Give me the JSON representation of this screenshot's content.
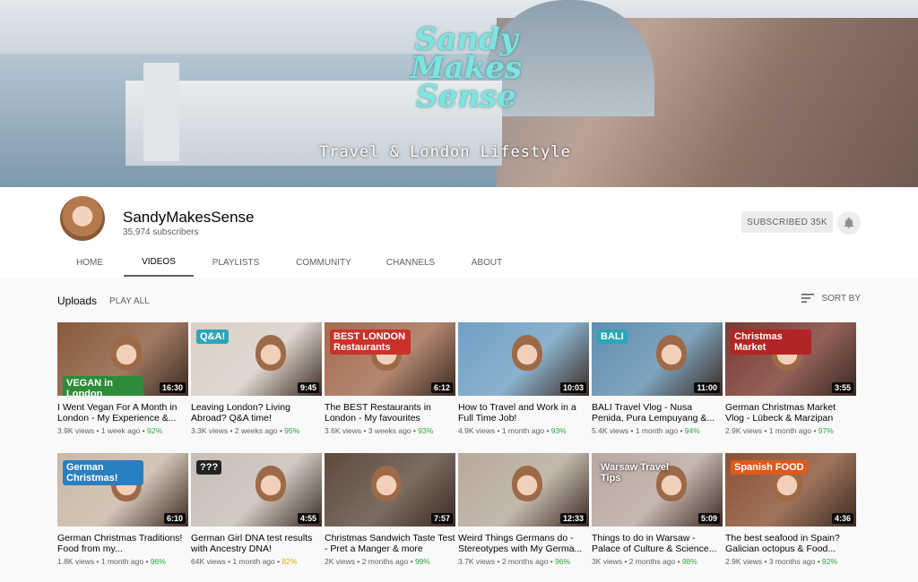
{
  "banner": {
    "logo_text": "Sandy Makes Sense",
    "tagline": "Travel & London Lifestyle"
  },
  "channel": {
    "name": "SandyMakesSense",
    "subscribers": "35,974 subscribers",
    "subscribed_label": "SUBSCRIBED 35K",
    "icons": {
      "bell": "bell-icon",
      "sort": "sort-icon"
    }
  },
  "tabs": [
    {
      "label": "HOME",
      "active": false
    },
    {
      "label": "VIDEOS",
      "active": true
    },
    {
      "label": "PLAYLISTS",
      "active": false
    },
    {
      "label": "COMMUNITY",
      "active": false
    },
    {
      "label": "CHANNELS",
      "active": false
    },
    {
      "label": "ABOUT",
      "active": false
    }
  ],
  "section": {
    "title": "Uploads",
    "play_all": "PLAY ALL",
    "sort_by": "SORT BY"
  },
  "videos": [
    {
      "title": "I Went Vegan For A Month in London - My Experience &...",
      "views": "3.9K views",
      "age": "1 week ago",
      "rating": "92%",
      "duration": "16:30",
      "thumb_text": "VEGAN in London",
      "bg": "#8a5a3c",
      "accent": "#2e8b3a"
    },
    {
      "title": "Leaving London? Living Abroad? Q&A time!",
      "views": "3.3K views",
      "age": "2 weeks ago",
      "rating": "95%",
      "duration": "9:45",
      "thumb_text": "Q&A!",
      "bg": "#d9cfc6",
      "accent": "#2aa6b8"
    },
    {
      "title": "The BEST Restaurants in London - My favourites",
      "views": "3.6K views",
      "age": "3 weeks ago",
      "rating": "93%",
      "duration": "6:12",
      "thumb_text": "BEST LONDON Restaurants",
      "bg": "#a36b4f",
      "accent": "#c8322a"
    },
    {
      "title": "How to Travel and Work in a Full Time Job!",
      "views": "4.9K views",
      "age": "1 month ago",
      "rating": "93%",
      "duration": "10:03",
      "thumb_text": "",
      "bg": "#6fa0c4",
      "accent": "#d63a2c"
    },
    {
      "title": "BALI Travel Vlog - Nusa Penida, Pura Lempuyang &...",
      "views": "5.4K views",
      "age": "1 month ago",
      "rating": "94%",
      "duration": "11:00",
      "thumb_text": "BALI",
      "bg": "#5f8fb0",
      "accent": "#2aa6b8"
    },
    {
      "title": "German Christmas Market Vlog - Lübeck & Marzipan",
      "views": "2.9K views",
      "age": "1 month ago",
      "rating": "97%",
      "duration": "3:55",
      "thumb_text": "Christmas Market",
      "bg": "#7a3a32",
      "accent": "#b32424"
    },
    {
      "title": "German Christmas Traditions! Food from my...",
      "views": "1.8K views",
      "age": "1 month ago",
      "rating": "96%",
      "duration": "6:10",
      "thumb_text": "German Christmas!",
      "bg": "#c9b8a6",
      "accent": "#2a7fc1"
    },
    {
      "title": "German Girl DNA test results with Ancestry DNA!",
      "views": "64K views",
      "age": "1 month ago",
      "rating": "82%",
      "duration": "4:55",
      "thumb_text": "???",
      "bg": "#c7bfb6",
      "accent": "#222222"
    },
    {
      "title": "Christmas Sandwich Taste Test - Pret a Manger & more",
      "views": "2K views",
      "age": "2 months ago",
      "rating": "99%",
      "duration": "7:57",
      "thumb_text": "",
      "bg": "#5c4a3c",
      "accent": "#b98a3a"
    },
    {
      "title": "Weird Things Germans do - Stereotypes with My Germa...",
      "views": "3.7K views",
      "age": "2 months ago",
      "rating": "96%",
      "duration": "12:33",
      "thumb_text": "",
      "bg": "#b7a99a",
      "accent": "#d21f1f"
    },
    {
      "title": "Things to do in Warsaw - Palace of Culture & Science...",
      "views": "3K views",
      "age": "2 months ago",
      "rating": "98%",
      "duration": "5:09",
      "thumb_text": "Warsaw Travel Tips",
      "bg": "#b9a8a0",
      "accent": "#ffffff"
    },
    {
      "title": "The best seafood in Spain? Galician octopus & Food...",
      "views": "2.9K views",
      "age": "3 months ago",
      "rating": "92%",
      "duration": "4:36",
      "thumb_text": "Spanish FOOD",
      "bg": "#8a5234",
      "accent": "#e05a1a"
    }
  ]
}
